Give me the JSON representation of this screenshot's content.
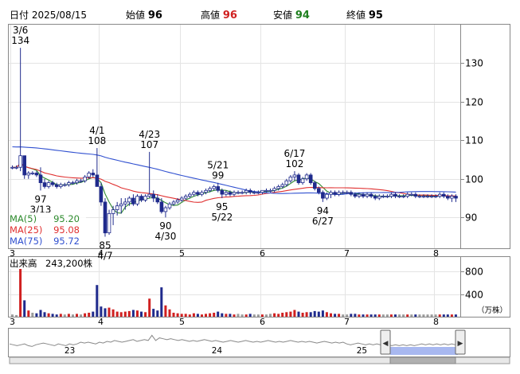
{
  "header": {
    "date_label": "日付",
    "date_value": "2025/08/15",
    "open_label": "始値",
    "open_value": "96",
    "high_label": "高値",
    "high_value": "96",
    "low_label": "安値",
    "low_value": "94",
    "close_label": "終値",
    "close_value": "95"
  },
  "colors": {
    "up": "#ffffff",
    "down": "#1f2a8c",
    "ma5": "#2e8b2e",
    "ma25": "#e03030",
    "ma75": "#3050d0",
    "high_value": "#d02020",
    "low_value": "#208020",
    "volume_up": "#d02020",
    "volume_down": "#1f2a8c",
    "volume_flat": "#9a9a9a",
    "navigator_window": "#a8b8f0"
  },
  "legend": [
    {
      "name": "MA(5)",
      "value": "95.20",
      "color_key": "ma5"
    },
    {
      "name": "MA(25)",
      "value": "95.08",
      "color_key": "ma25"
    },
    {
      "name": "MA(75)",
      "value": "95.72",
      "color_key": "ma75"
    }
  ],
  "volume_label": {
    "title": "出来高",
    "value": "243,200株",
    "unit": "（万株）"
  },
  "chart_data": [
    {
      "type": "candlestick",
      "x_ticks": [
        {
          "label": "3",
          "t": 0
        },
        {
          "label": "4",
          "t": 22
        },
        {
          "label": "5",
          "t": 42
        },
        {
          "label": "6",
          "t": 62
        },
        {
          "label": "7",
          "t": 83
        },
        {
          "label": "8",
          "t": 105
        }
      ],
      "ylim": [
        82,
        140
      ],
      "y_ticks": [
        90,
        100,
        110,
        120,
        130
      ],
      "grid": true,
      "annotations": [
        {
          "date": "3/6",
          "value": "134",
          "t": 2,
          "side": "above"
        },
        {
          "date": "3/13",
          "value": "97",
          "t": 7,
          "side": "below"
        },
        {
          "date": "4/1",
          "value": "108",
          "t": 21,
          "side": "above"
        },
        {
          "date": "4/7",
          "value": "85",
          "t": 23,
          "side": "below"
        },
        {
          "date": "4/23",
          "value": "107",
          "t": 34,
          "side": "above"
        },
        {
          "date": "4/30",
          "value": "90",
          "t": 38,
          "side": "below"
        },
        {
          "date": "5/21",
          "value": "99",
          "t": 51,
          "side": "above"
        },
        {
          "date": "5/22",
          "value": "95",
          "t": 52,
          "side": "below"
        },
        {
          "date": "6/17",
          "value": "102",
          "t": 70,
          "side": "above"
        },
        {
          "date": "6/27",
          "value": "94",
          "t": 77,
          "side": "below"
        }
      ],
      "candles": [
        [
          103,
          103.5,
          102.5,
          103
        ],
        [
          103,
          103.5,
          102.5,
          103
        ],
        [
          103,
          134,
          102,
          106
        ],
        [
          106,
          106,
          100,
          101
        ],
        [
          101,
          102,
          100,
          101.5
        ],
        [
          101.5,
          102,
          101,
          101.5
        ],
        [
          101.5,
          102,
          100.5,
          101
        ],
        [
          101,
          103,
          97,
          99
        ],
        [
          99,
          100,
          97.5,
          98
        ],
        [
          98,
          99.5,
          97.5,
          99
        ],
        [
          99,
          99.5,
          98,
          98.5
        ],
        [
          98.5,
          99,
          97.5,
          98
        ],
        [
          98,
          99,
          97.5,
          98.5
        ],
        [
          98.5,
          99,
          98,
          98.5
        ],
        [
          98.5,
          99.5,
          98,
          99
        ],
        [
          99,
          99.5,
          98.5,
          99
        ],
        [
          99,
          100,
          98.5,
          99.5
        ],
        [
          99.5,
          100,
          99,
          99.5
        ],
        [
          99.5,
          101,
          99,
          100.5
        ],
        [
          100.5,
          102,
          100,
          101.5
        ],
        [
          101.5,
          102.5,
          100.5,
          101
        ],
        [
          101,
          108,
          98,
          98
        ],
        [
          98,
          99,
          93,
          94
        ],
        [
          94,
          95,
          85,
          86
        ],
        [
          86,
          92,
          85.5,
          91
        ],
        [
          91,
          93,
          88,
          92
        ],
        [
          92,
          94,
          90.5,
          93
        ],
        [
          93,
          95,
          91,
          93.5
        ],
        [
          93.5,
          95,
          92,
          94
        ],
        [
          94,
          95.5,
          93,
          95
        ],
        [
          95,
          96,
          93,
          93.5
        ],
        [
          93.5,
          96,
          93,
          95.5
        ],
        [
          95.5,
          96,
          94,
          94.5
        ],
        [
          94.5,
          96,
          94,
          95.5
        ],
        [
          95.5,
          107,
          95,
          96
        ],
        [
          96,
          97,
          94,
          95
        ],
        [
          95,
          96,
          93.5,
          94
        ],
        [
          94,
          95,
          91,
          91.5
        ],
        [
          91.5,
          93,
          90,
          92.5
        ],
        [
          92.5,
          94,
          92,
          93.5
        ],
        [
          93.5,
          94.5,
          93,
          94
        ],
        [
          94,
          95,
          93.5,
          94.5
        ],
        [
          94.5,
          95.5,
          94,
          95
        ],
        [
          95,
          96,
          94.5,
          95.5
        ],
        [
          95.5,
          96.5,
          95,
          96
        ],
        [
          96,
          97,
          95.5,
          96.5
        ],
        [
          96.5,
          97,
          95.5,
          96
        ],
        [
          96,
          97,
          95.5,
          96.5
        ],
        [
          96.5,
          97.5,
          96,
          97
        ],
        [
          97,
          98,
          96.5,
          97.5
        ],
        [
          97.5,
          98.5,
          97,
          98
        ],
        [
          98,
          99,
          96.5,
          97
        ],
        [
          97,
          97.5,
          95,
          96
        ],
        [
          96,
          97,
          95.5,
          96.5
        ],
        [
          96.5,
          97,
          95.5,
          96
        ],
        [
          96,
          97,
          95.5,
          96.5
        ],
        [
          96.5,
          97,
          96,
          96.5
        ],
        [
          96.5,
          97,
          96,
          96.5
        ],
        [
          96.5,
          97.5,
          96,
          97
        ],
        [
          97,
          97.5,
          96,
          96.5
        ],
        [
          96.5,
          97,
          96,
          96.5
        ],
        [
          96.5,
          97,
          96,
          96.5
        ],
        [
          96.5,
          97,
          96,
          97
        ],
        [
          97,
          97.5,
          96.5,
          97
        ],
        [
          97,
          97.5,
          96.5,
          97
        ],
        [
          97,
          98,
          96.5,
          97.5
        ],
        [
          97.5,
          98.5,
          97,
          98
        ],
        [
          98,
          99,
          97.5,
          98.5
        ],
        [
          98.5,
          100,
          98,
          99.5
        ],
        [
          99.5,
          101,
          99,
          100.5
        ],
        [
          100.5,
          102,
          99.5,
          101
        ],
        [
          101,
          101.5,
          98.5,
          99
        ],
        [
          99,
          100.5,
          98.5,
          100
        ],
        [
          100,
          101.5,
          99.5,
          101
        ],
        [
          101,
          101.5,
          98.5,
          99
        ],
        [
          99,
          99.5,
          97,
          97.5
        ],
        [
          97.5,
          98,
          96,
          96.5
        ],
        [
          96.5,
          97,
          94,
          95
        ],
        [
          95,
          96.5,
          94.5,
          96
        ],
        [
          96,
          97,
          95,
          96.5
        ],
        [
          96.5,
          97,
          95.5,
          96
        ],
        [
          96,
          97,
          95.5,
          96.5
        ],
        [
          96.5,
          97,
          96,
          96.5
        ],
        [
          96.5,
          97,
          96,
          96.5
        ],
        [
          96.5,
          97,
          95.5,
          96
        ],
        [
          96,
          96.5,
          95,
          95.5
        ],
        [
          95.5,
          96.5,
          95,
          96
        ],
        [
          96,
          96.5,
          95,
          95.5
        ],
        [
          95.5,
          96.5,
          95,
          96
        ],
        [
          96,
          96.5,
          95,
          95.5
        ],
        [
          95.5,
          96,
          94.5,
          95
        ],
        [
          95,
          96,
          94.5,
          95.5
        ],
        [
          95.5,
          96,
          95,
          95.5
        ],
        [
          95.5,
          96,
          95,
          95.5
        ],
        [
          95.5,
          96.5,
          95,
          96
        ],
        [
          96,
          96.5,
          95,
          95.5
        ],
        [
          95.5,
          96,
          95,
          95.5
        ],
        [
          95.5,
          96,
          95,
          95.5
        ],
        [
          95.5,
          96.5,
          95,
          96
        ],
        [
          96,
          96.5,
          95.5,
          96
        ],
        [
          96,
          96.5,
          95,
          95.5
        ],
        [
          95.5,
          96,
          95,
          95.5
        ],
        [
          95.5,
          96,
          95,
          95.5
        ],
        [
          95.5,
          96,
          95,
          95.5
        ],
        [
          95.5,
          96,
          95,
          95.5
        ],
        [
          95.5,
          96,
          95,
          95.5
        ],
        [
          95.5,
          96.5,
          95,
          96
        ],
        [
          96,
          96.5,
          95,
          95.5
        ],
        [
          95.5,
          96,
          94.5,
          95
        ],
        [
          95,
          96,
          94,
          95.5
        ],
        [
          95.5,
          96,
          94,
          95
        ]
      ],
      "volume": {
        "ylim": [
          0,
          1000
        ],
        "y_ticks": [
          400,
          800
        ],
        "values": [
          40,
          30,
          1050,
          290,
          110,
          70,
          60,
          120,
          80,
          60,
          50,
          40,
          50,
          40,
          50,
          40,
          50,
          40,
          60,
          70,
          90,
          560,
          180,
          150,
          160,
          130,
          90,
          80,
          90,
          100,
          120,
          110,
          90,
          80,
          320,
          140,
          110,
          520,
          200,
          130,
          70,
          60,
          50,
          50,
          40,
          60,
          50,
          40,
          50,
          60,
          70,
          90,
          60,
          50,
          50,
          40,
          50,
          40,
          40,
          50,
          40,
          40,
          40,
          40,
          50,
          60,
          50,
          70,
          80,
          90,
          120,
          90,
          70,
          80,
          80,
          100,
          90,
          110,
          80,
          60,
          50,
          50,
          40,
          40,
          50,
          50,
          40,
          40,
          40,
          40,
          40,
          40,
          40,
          40,
          40,
          40,
          40,
          40,
          40,
          40,
          40,
          40,
          40,
          40,
          40,
          40,
          40,
          40,
          40,
          40,
          40
        ]
      }
    }
  ],
  "navigator": {
    "labels": [
      {
        "text": "23",
        "pos": 0.135
      },
      {
        "text": "24",
        "pos": 0.465
      },
      {
        "text": "25",
        "pos": 0.79
      }
    ],
    "series": [
      20,
      19,
      18,
      19,
      20,
      18,
      17,
      19,
      20,
      21,
      20,
      19,
      18,
      20,
      19,
      18,
      20,
      19,
      20,
      22,
      21,
      22,
      21,
      20,
      22,
      21,
      23,
      22,
      24,
      23,
      22,
      23,
      24,
      25,
      23,
      24,
      25,
      24,
      30,
      24,
      27,
      26,
      25,
      26,
      25,
      24,
      25,
      24,
      23,
      24,
      23,
      24,
      25,
      24,
      23,
      24,
      23,
      22,
      23,
      24,
      23,
      22,
      23,
      24,
      23,
      22,
      23,
      22,
      23,
      24,
      23,
      22,
      23,
      22,
      23,
      24,
      23,
      22,
      23,
      22,
      23,
      22,
      21,
      22,
      23,
      22,
      21,
      22,
      21,
      22,
      20,
      19,
      20,
      21,
      20,
      19,
      20,
      19,
      20,
      19,
      20,
      19,
      18,
      19,
      18,
      19,
      18,
      19,
      18,
      19,
      20,
      19,
      20,
      19,
      20,
      19,
      20,
      19,
      20,
      19
    ]
  }
}
